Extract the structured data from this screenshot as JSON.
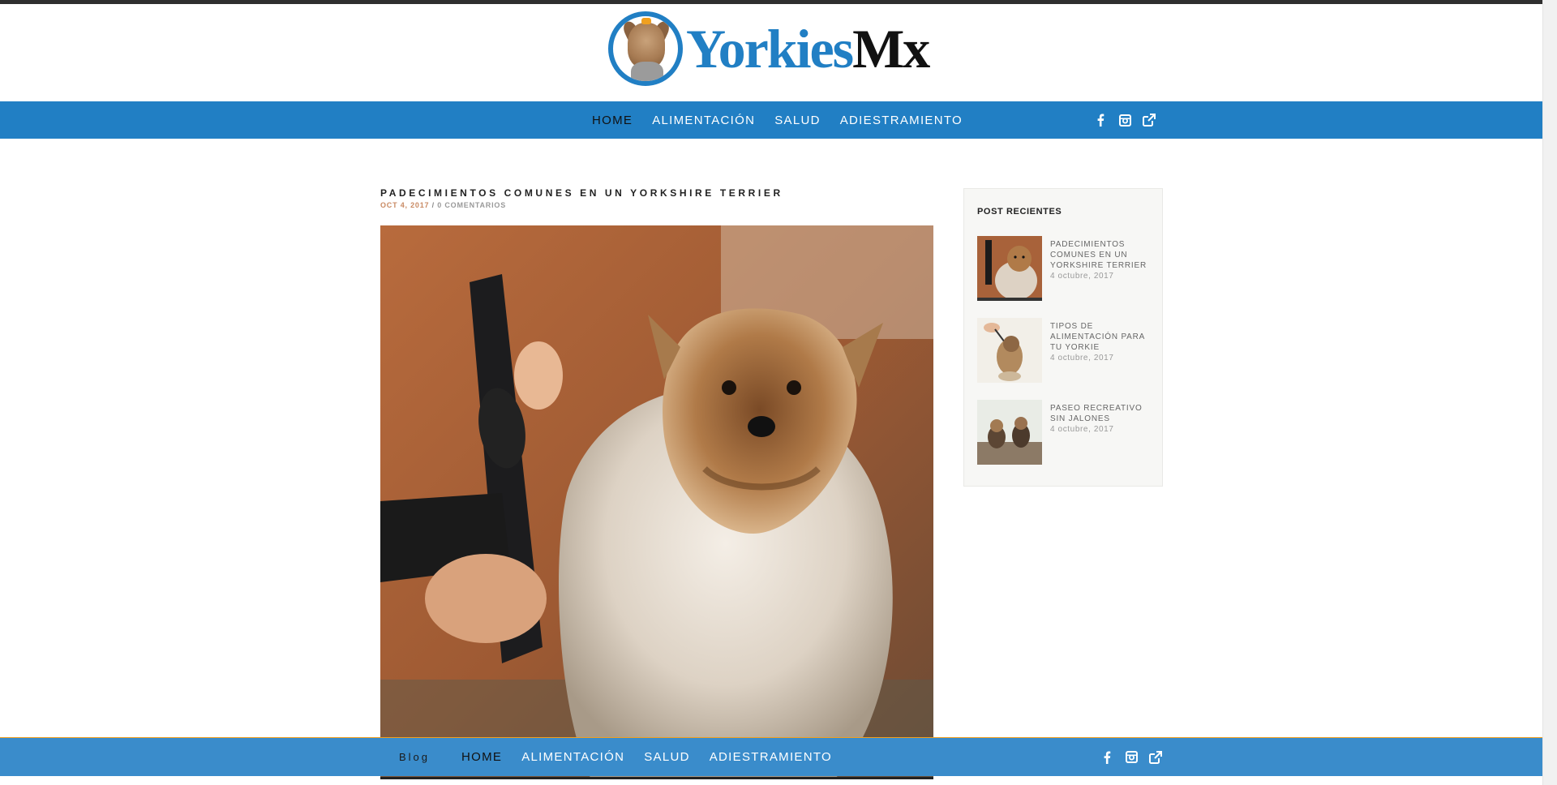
{
  "site": {
    "logo_part1": "Yorkies",
    "logo_part2": "Mx"
  },
  "nav": {
    "items": [
      {
        "label": "HOME",
        "active": true
      },
      {
        "label": "ALIMENTACIÓN",
        "active": false
      },
      {
        "label": "SALUD",
        "active": false
      },
      {
        "label": "ADIESTRAMIENTO",
        "active": false
      }
    ],
    "social": [
      "facebook-icon",
      "instagram-icon",
      "external-link-icon"
    ]
  },
  "sticky_nav": {
    "blog_label": "Blog"
  },
  "post": {
    "title": "PADECIMIENTOS COMUNES EN UN YORKSHIRE TERRIER",
    "date": "OCT 4, 2017",
    "separator": "/",
    "comments": "0 COMENTARIOS"
  },
  "sidebar": {
    "title": "POST RECIENTES",
    "items": [
      {
        "title": "PADECIMIENTOS COMUNES EN UN YORKSHIRE TERRIER",
        "date": "4 octubre, 2017"
      },
      {
        "title": "TIPOS DE ALIMENTACIÓN PARA TU YORKIE",
        "date": "4 octubre, 2017"
      },
      {
        "title": "PASEO RECREATIVO SIN JALONES",
        "date": "4 octubre, 2017"
      }
    ]
  },
  "colors": {
    "brand_blue": "#217fc4",
    "sticky_blue": "#3a8ccb",
    "meta_accent": "#c98a63"
  }
}
